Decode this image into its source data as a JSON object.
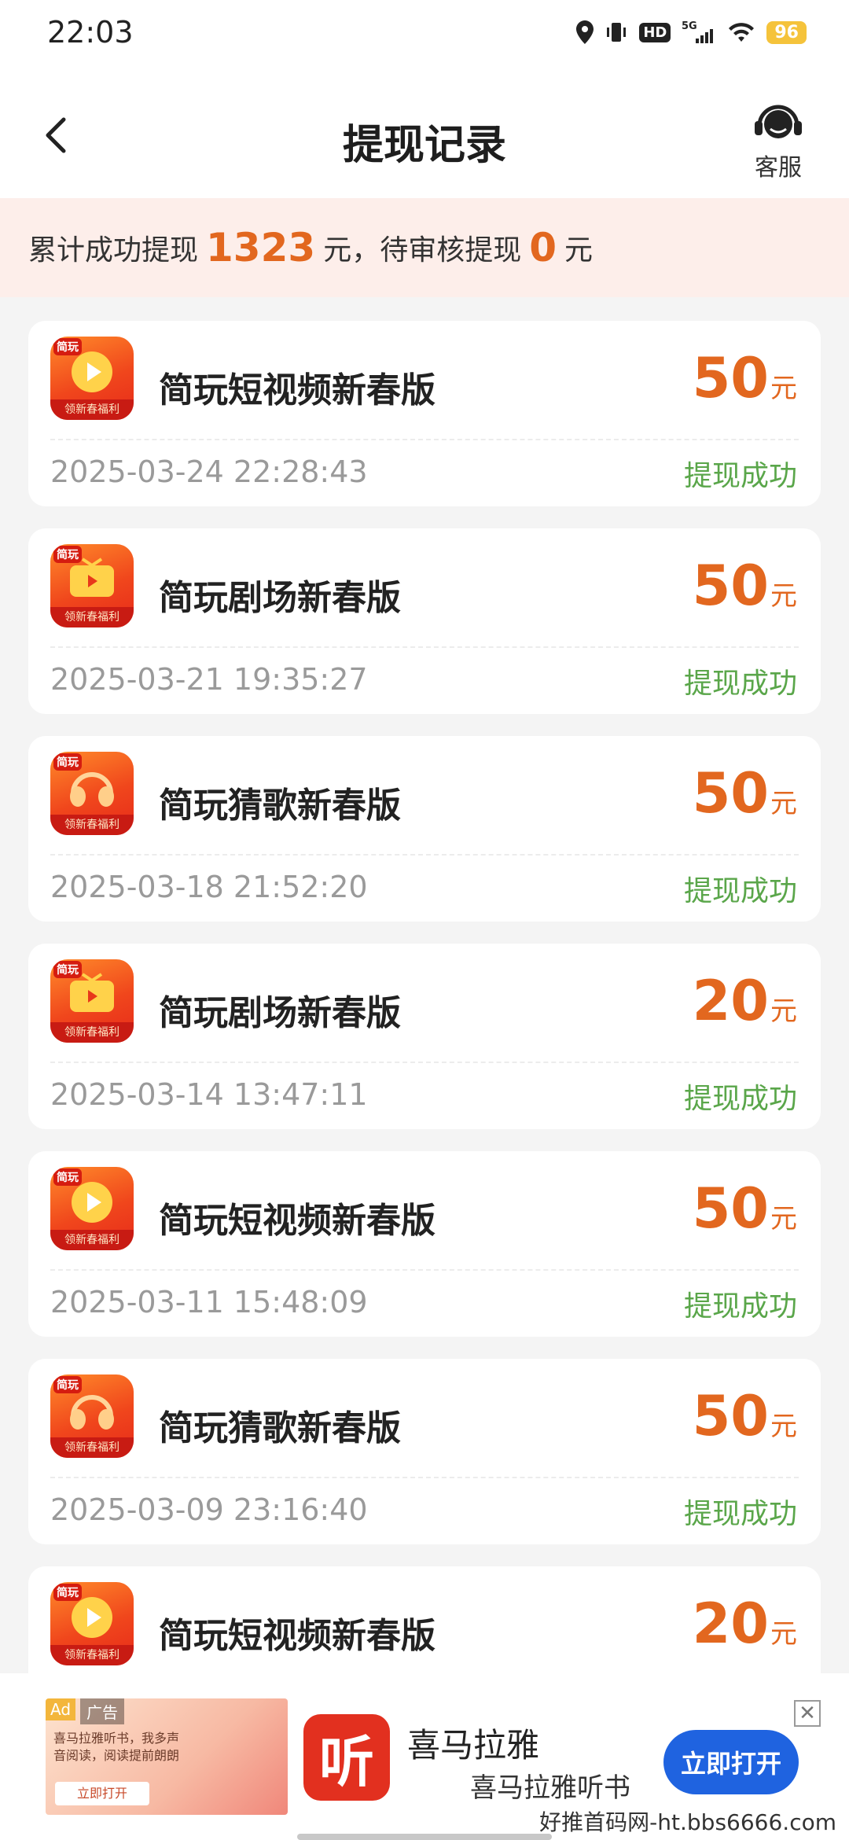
{
  "status_bar": {
    "time": "22:03",
    "icons": [
      "location-icon",
      "vibrate-icon",
      "hd-icon",
      "signal-5g-icon",
      "wifi-icon",
      "battery-icon"
    ],
    "hd": "HD",
    "network": "5G",
    "battery": "96"
  },
  "header": {
    "title": "提现记录",
    "service_label": "客服"
  },
  "summary": {
    "prefix": "累计成功提现",
    "total": "1323",
    "mid": "元，待审核提现",
    "pending": "0",
    "suffix": "元"
  },
  "records": [
    {
      "app": "简玩短视频新春版",
      "amount": "50",
      "unit": "元",
      "time": "2025-03-24 22:28:43",
      "status": "提现成功",
      "icon": "play-icon"
    },
    {
      "app": "简玩剧场新春版",
      "amount": "50",
      "unit": "元",
      "time": "2025-03-21 19:35:27",
      "status": "提现成功",
      "icon": "tv-icon"
    },
    {
      "app": "简玩猜歌新春版",
      "amount": "50",
      "unit": "元",
      "time": "2025-03-18 21:52:20",
      "status": "提现成功",
      "icon": "headphones-icon"
    },
    {
      "app": "简玩剧场新春版",
      "amount": "20",
      "unit": "元",
      "time": "2025-03-14 13:47:11",
      "status": "提现成功",
      "icon": "tv-icon"
    },
    {
      "app": "简玩短视频新春版",
      "amount": "50",
      "unit": "元",
      "time": "2025-03-11 15:48:09",
      "status": "提现成功",
      "icon": "play-icon"
    },
    {
      "app": "简玩猜歌新春版",
      "amount": "50",
      "unit": "元",
      "time": "2025-03-09 23:16:40",
      "status": "提现成功",
      "icon": "headphones-icon"
    },
    {
      "app": "简玩短视频新春版",
      "amount": "20",
      "unit": "元",
      "time": "",
      "status": "",
      "icon": "play-icon"
    }
  ],
  "icon_texts": {
    "tag": "简玩",
    "ribbon": "领新春福利"
  },
  "ad": {
    "badge": "Ad",
    "label": "广告",
    "image_text": "喜马拉雅听书，我多声音阅读，阅读提前朗朗",
    "image_button": "立即打开",
    "logo_char": "听",
    "title": "喜马拉雅",
    "subtitle": "喜马拉雅听书",
    "open_button": "立即打开",
    "close": "✕"
  },
  "watermark": "好推首码网-ht.bbs6666.com",
  "colors": {
    "accent": "#e2671f",
    "success": "#5aa64a",
    "banner_bg": "#fdeeea",
    "ad_button": "#1f63e0"
  }
}
